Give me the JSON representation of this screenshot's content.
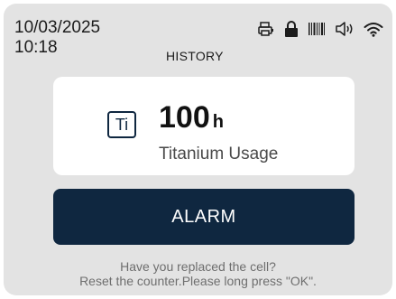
{
  "status_bar": {
    "date": "10/03/2025",
    "time": "10:18",
    "icons": [
      "printer-icon",
      "lock-icon",
      "barcode-icon",
      "speaker-icon",
      "wifi-icon"
    ]
  },
  "page": {
    "title": "HISTORY"
  },
  "usage": {
    "badge": "Ti",
    "value": "100",
    "unit": "h",
    "label": "Titanium Usage"
  },
  "alarm": {
    "label": "ALARM"
  },
  "message": {
    "line1": "Have you replaced the cell?",
    "line2": "Reset the counter.Please long press \"OK\"."
  },
  "colors": {
    "screen_background": "#e3e3e3",
    "card_background": "#ffffff",
    "accent_navy": "#0f2740",
    "text_muted": "#6e6e6e"
  }
}
